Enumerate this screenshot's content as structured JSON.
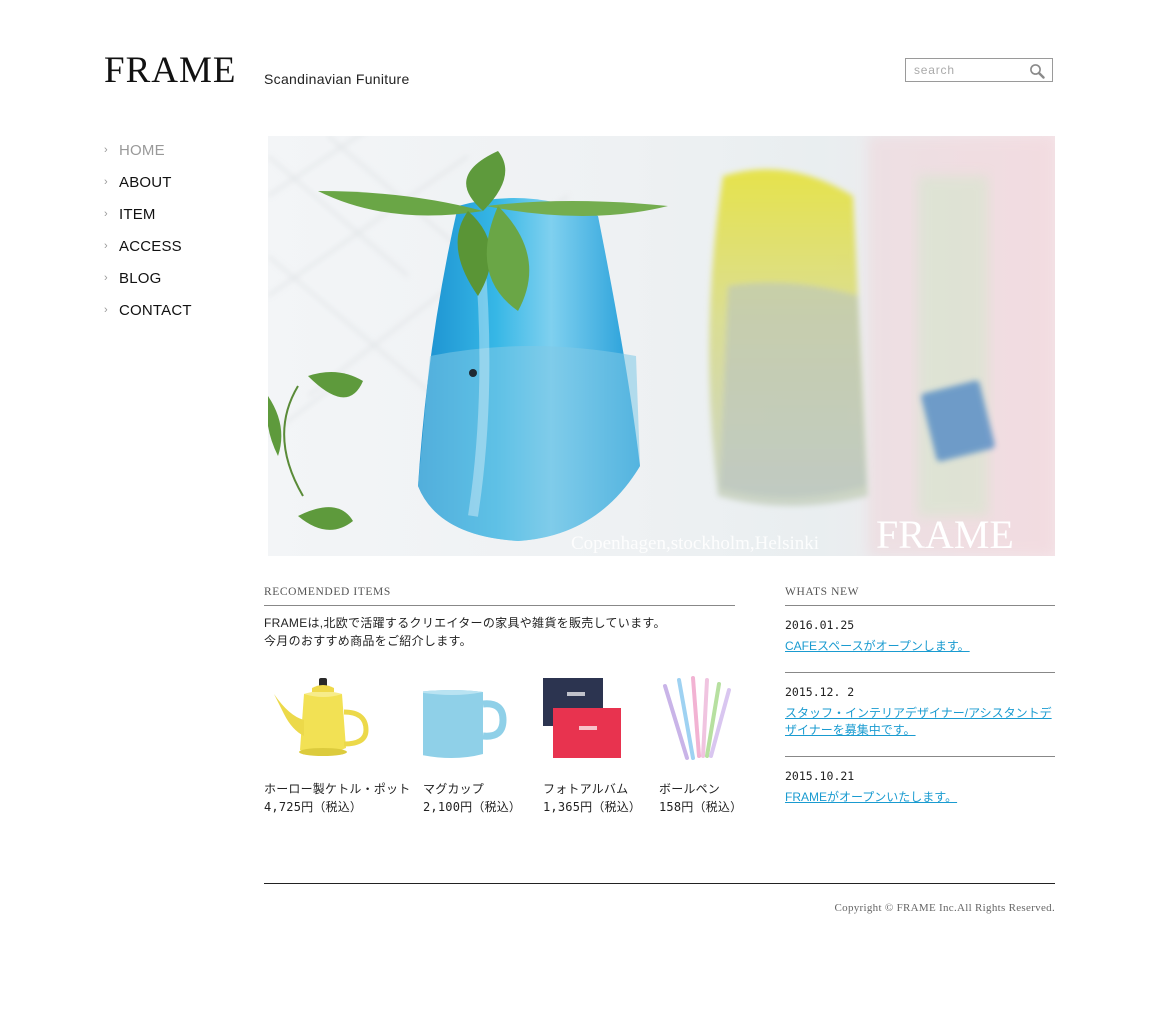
{
  "header": {
    "logo": "FRAME",
    "tagline": "Scandinavian Funiture",
    "search_placeholder": "search"
  },
  "nav": {
    "items": [
      {
        "label": "HOME",
        "active": true
      },
      {
        "label": "ABOUT"
      },
      {
        "label": "ITEM"
      },
      {
        "label": "ACCESS"
      },
      {
        "label": "BLOG"
      },
      {
        "label": "CONTACT"
      }
    ]
  },
  "hero": {
    "caption": "Copenhagen,stockholm,Helsinki",
    "brand": "FRAME"
  },
  "recommended": {
    "title": "RECOMENDED ITEMS",
    "intro_line1": "FRAMEは,北欧で活躍するクリエイターの家具や雑貨を販売しています。",
    "intro_line2": "今月のおすすめ商品をご紹介します。",
    "products": [
      {
        "name": "ホーロー製ケトル・ポット",
        "price": "4,725円（税込）",
        "icon": "kettle-icon"
      },
      {
        "name": "マグカップ",
        "price": "2,100円（税込）",
        "icon": "mug-icon"
      },
      {
        "name": "フォトアルバム",
        "price": "1,365円（税込）",
        "icon": "photo-album-icon"
      },
      {
        "name": "ボールペン",
        "price": "158円（税込）",
        "icon": "ballpoint-pen-icon"
      }
    ]
  },
  "news": {
    "title": "WHATS NEW",
    "items": [
      {
        "date": "2016.01.25",
        "text": "CAFEスペースがオープンします。"
      },
      {
        "date": "2015.12. 2",
        "text": "スタッフ・インテリアデザイナー/アシスタントデザイナーを募集中です。"
      },
      {
        "date": "2015.10.21",
        "text": "FRAMEがオープンいたします。"
      }
    ]
  },
  "footer": {
    "copyright": "Copyright © FRAME  Inc.All Rights Reserved."
  },
  "colors": {
    "link": "#1a9bd0",
    "nav_active": "#999999"
  }
}
